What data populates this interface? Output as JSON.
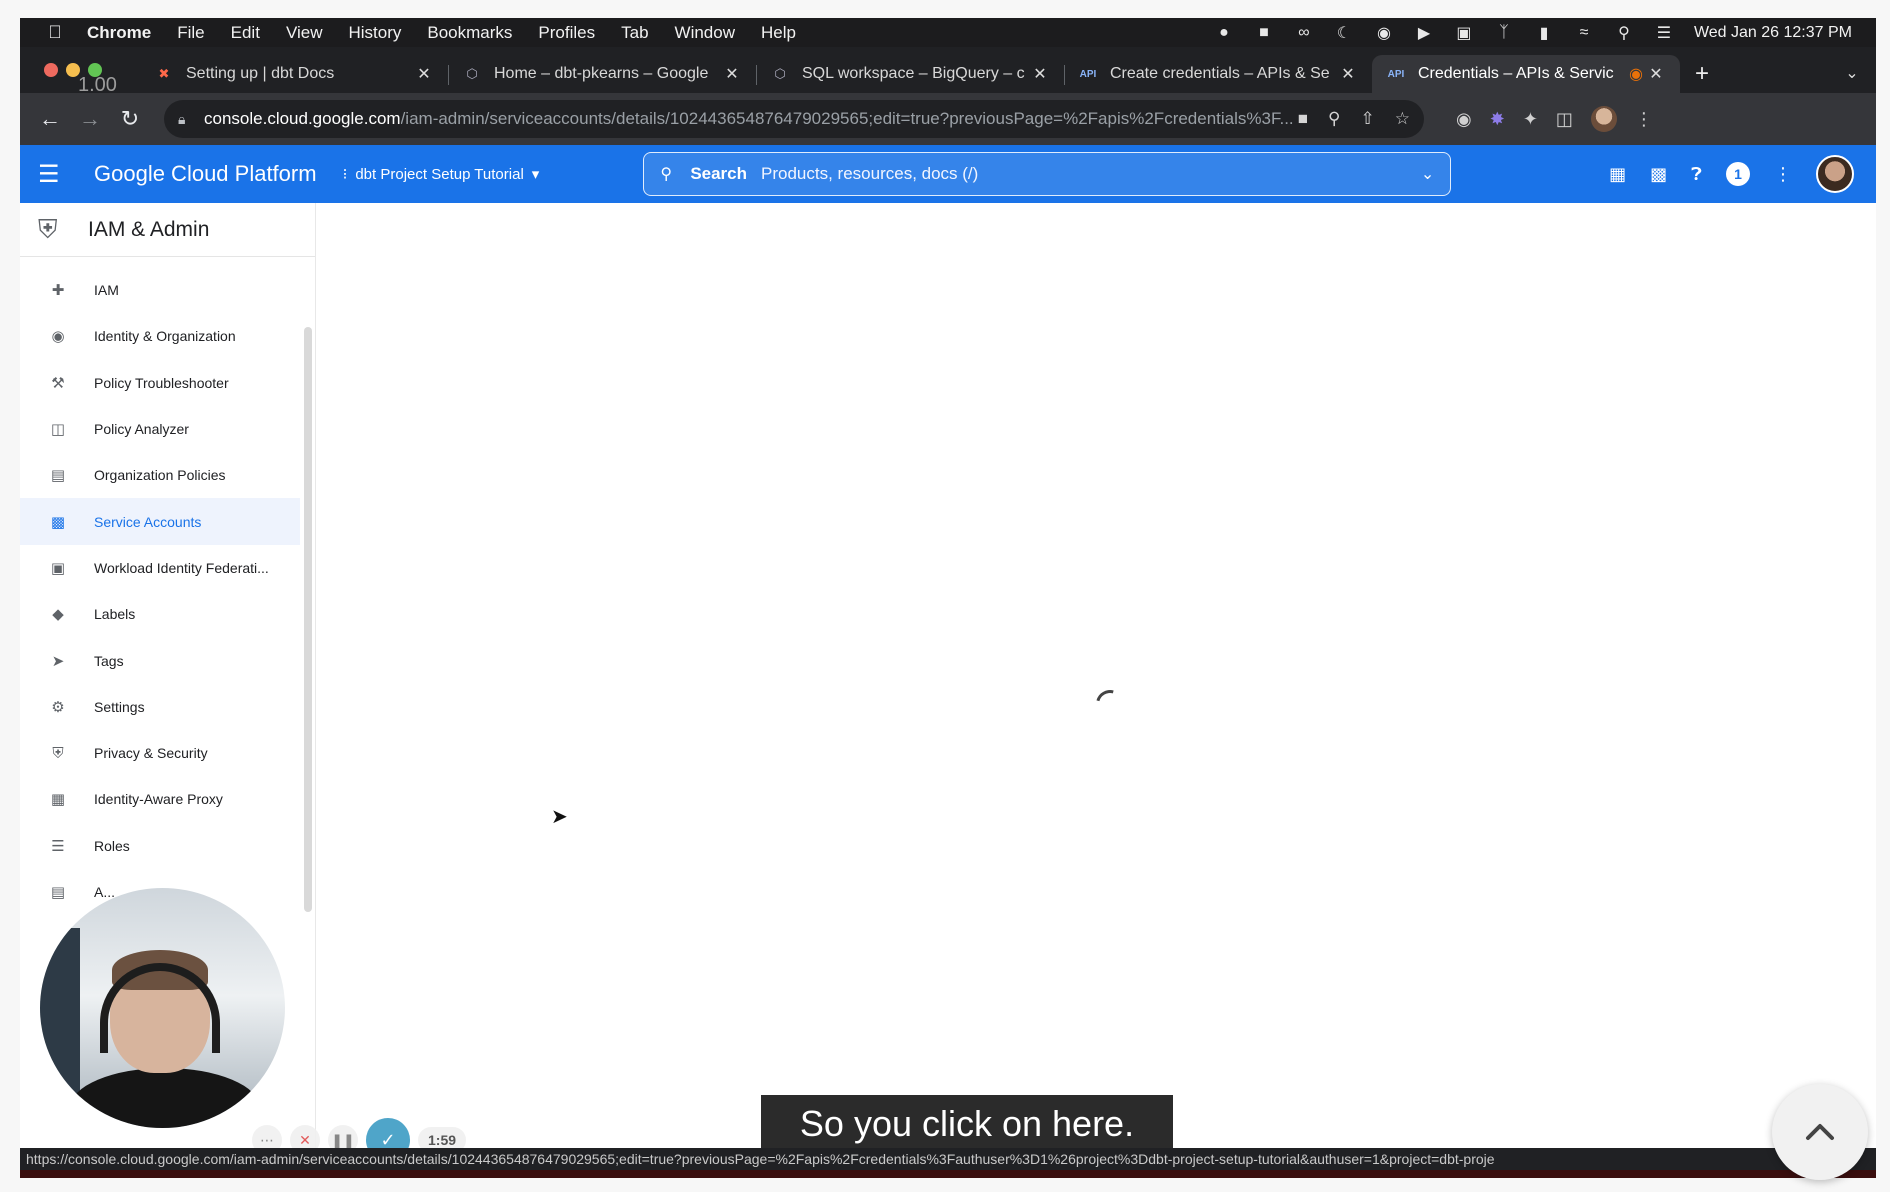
{
  "menubar": {
    "app": "Chrome",
    "items": [
      "File",
      "Edit",
      "View",
      "History",
      "Bookmarks",
      "Profiles",
      "Tab",
      "Window",
      "Help"
    ],
    "clock": "Wed Jan 26  12:37 PM"
  },
  "overlay": {
    "speed": "1.00"
  },
  "tabs": [
    {
      "label": "Setting up | dbt Docs",
      "favicon": "dbt-icon"
    },
    {
      "label": "Home – dbt-pkearns – Google",
      "favicon": "gcp-icon"
    },
    {
      "label": "SQL workspace – BigQuery – c",
      "favicon": "gcp-icon"
    },
    {
      "label": "Create credentials – APIs & Se",
      "favicon": "api-icon"
    },
    {
      "label": "Credentials – APIs & Servic",
      "favicon": "api-icon"
    }
  ],
  "address": {
    "host": "console.cloud.google.com",
    "path": "/iam-admin/serviceaccounts/details/102443654876479029565;edit=true?previousPage=%2Fapis%2Fcredentials%3F..."
  },
  "gcp": {
    "title": "Google Cloud Platform",
    "project": "dbt Project Setup Tutorial",
    "search_label": "Search",
    "search_placeholder": "Products, resources, docs (/)",
    "notification_count": "1"
  },
  "sidebar": {
    "title": "IAM & Admin",
    "items": [
      {
        "label": "IAM",
        "icon": "person-add-icon"
      },
      {
        "label": "Identity & Organization",
        "icon": "account-circle-icon"
      },
      {
        "label": "Policy Troubleshooter",
        "icon": "wrench-icon"
      },
      {
        "label": "Policy Analyzer",
        "icon": "document-search-icon"
      },
      {
        "label": "Organization Policies",
        "icon": "list-box-icon"
      },
      {
        "label": "Service Accounts",
        "icon": "service-account-icon"
      },
      {
        "label": "Workload Identity Federati...",
        "icon": "id-card-icon"
      },
      {
        "label": "Labels",
        "icon": "label-icon"
      },
      {
        "label": "Tags",
        "icon": "tag-icon"
      },
      {
        "label": "Settings",
        "icon": "gear-icon"
      },
      {
        "label": "Privacy & Security",
        "icon": "shield-icon"
      },
      {
        "label": "Identity-Aware Proxy",
        "icon": "proxy-icon"
      },
      {
        "label": "Roles",
        "icon": "roles-icon"
      },
      {
        "label": "A...",
        "icon": "audit-icon"
      }
    ],
    "active_index": 5
  },
  "recorder": {
    "time": "1:59"
  },
  "caption": "So you click on here.",
  "status_url": "https://console.cloud.google.com/iam-admin/serviceaccounts/details/102443654876479029565;edit=true?previousPage=%2Fapis%2Fcredentials%3Fauthuser%3D1%26project%3Ddbt-project-setup-tutorial&authuser=1&project=dbt-proje"
}
